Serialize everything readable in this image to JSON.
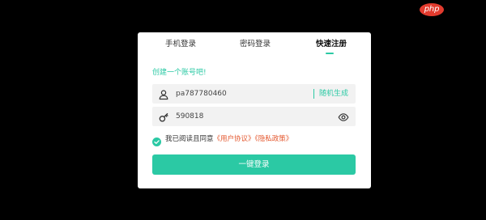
{
  "watermark": {
    "text": "php"
  },
  "tabs": [
    {
      "label": "手机登录",
      "active": false
    },
    {
      "label": "密码登录",
      "active": false
    },
    {
      "label": "快速注册",
      "active": true
    }
  ],
  "subtitle": "创建一个账号吧!",
  "account_field": {
    "icon": "user-icon",
    "value": "pa787780460",
    "action_label": "随机生成"
  },
  "password_field": {
    "icon": "key-icon",
    "value": "590818",
    "toggle_icon": "eye-icon"
  },
  "agreement": {
    "checked": true,
    "prefix": "我已阅读且同意",
    "user_agreement": "《用户协议》",
    "privacy_policy": "《隐私政策》"
  },
  "submit_label": "一键登录",
  "colors": {
    "accent": "#2bc9a4",
    "link": "#e4572e",
    "background": "#000000",
    "card": "#ffffff",
    "field": "#f2f2f2"
  }
}
